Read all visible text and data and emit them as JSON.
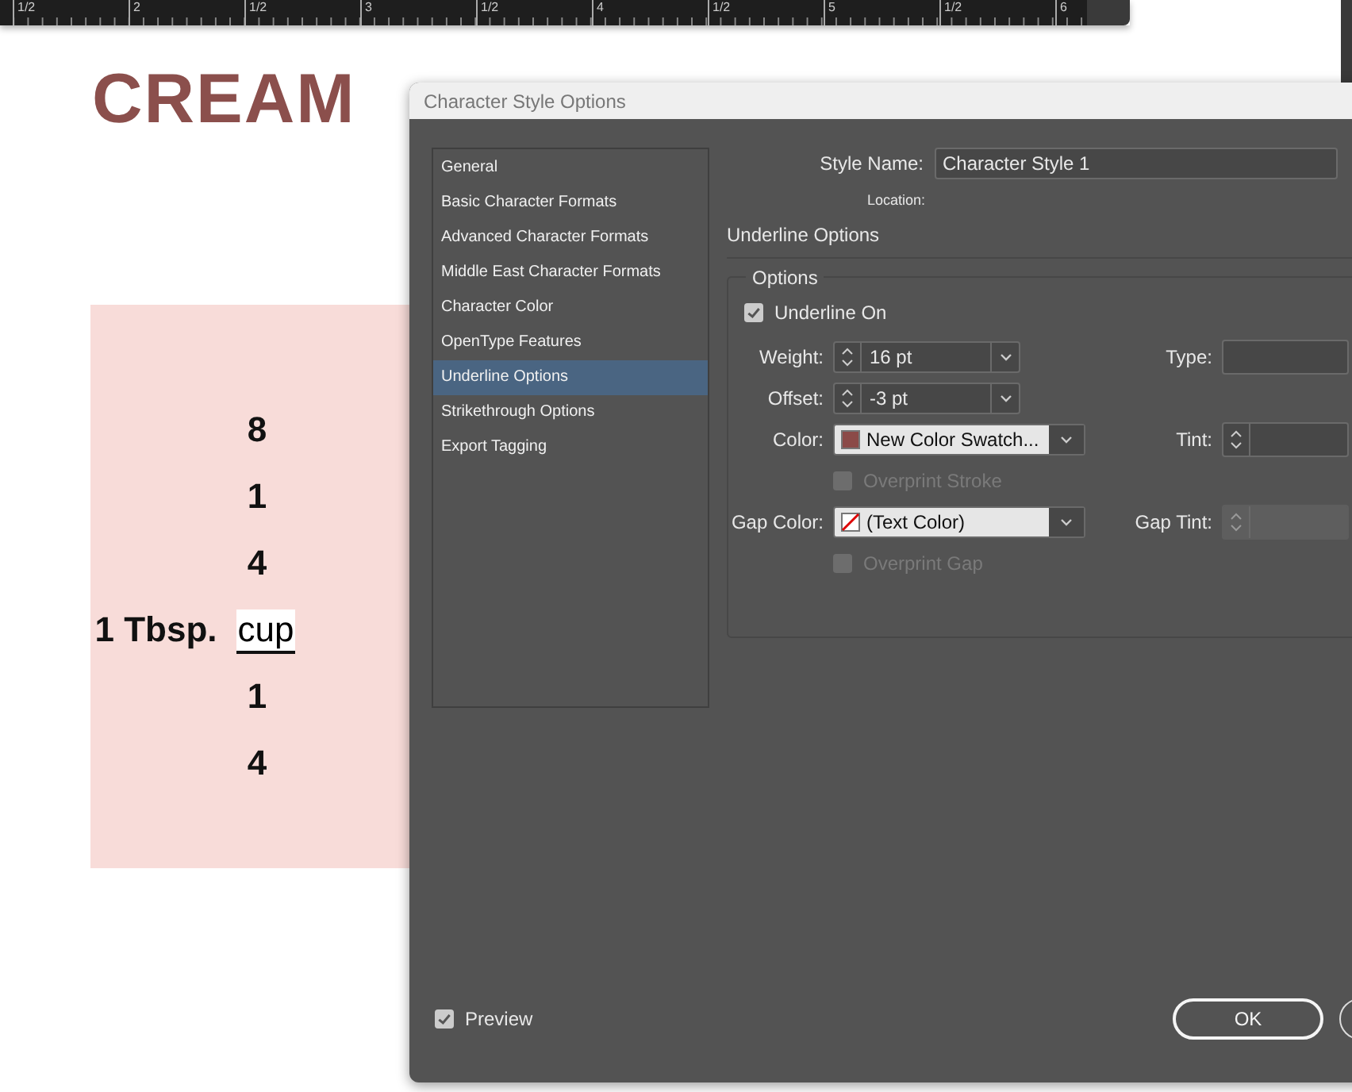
{
  "ruler": {
    "labels": [
      "1/2",
      "2",
      "1/2",
      "3",
      "1/2",
      "4",
      "1/2",
      "5",
      "1/2",
      "6"
    ]
  },
  "document": {
    "title": "CREAM",
    "lines": [
      {
        "amount": "8"
      },
      {
        "amount": "1"
      },
      {
        "amount": "4"
      },
      {
        "amount": "1 Tbsp.",
        "unit": "cup"
      },
      {
        "amount": "1"
      },
      {
        "amount": "4"
      }
    ]
  },
  "dialog": {
    "title": "Character Style Options",
    "categories": [
      {
        "label": "General",
        "selected": false
      },
      {
        "label": "Basic Character Formats",
        "selected": false
      },
      {
        "label": "Advanced Character Formats",
        "selected": false
      },
      {
        "label": "Middle East Character Formats",
        "selected": false
      },
      {
        "label": "Character Color",
        "selected": false
      },
      {
        "label": "OpenType Features",
        "selected": false
      },
      {
        "label": "Underline Options",
        "selected": true
      },
      {
        "label": "Strikethrough Options",
        "selected": false
      },
      {
        "label": "Export Tagging",
        "selected": false
      }
    ],
    "style_name": {
      "label": "Style Name:",
      "value": "Character Style 1"
    },
    "location_label": "Location:",
    "section_title": "Underline Options",
    "group": {
      "legend": "Options",
      "underline_on": {
        "label": "Underline On",
        "checked": true
      },
      "weight": {
        "label": "Weight:",
        "value": "16 pt"
      },
      "type": {
        "label": "Type:"
      },
      "offset": {
        "label": "Offset:",
        "value": "-3 pt"
      },
      "color": {
        "label": "Color:",
        "value": "New Color Swatch...",
        "kind": "solid",
        "color": "#8b4a48"
      },
      "tint": {
        "label": "Tint:"
      },
      "overprint_stroke": {
        "label": "Overprint Stroke",
        "disabled": true
      },
      "gap_color": {
        "label": "Gap Color:",
        "value": "(Text Color)",
        "kind": "none"
      },
      "gap_tint": {
        "label": "Gap Tint:",
        "disabled": true
      },
      "overprint_gap": {
        "label": "Overprint Gap",
        "disabled": true
      }
    },
    "preview": {
      "label": "Preview",
      "checked": true
    },
    "ok": {
      "label": "OK"
    }
  }
}
